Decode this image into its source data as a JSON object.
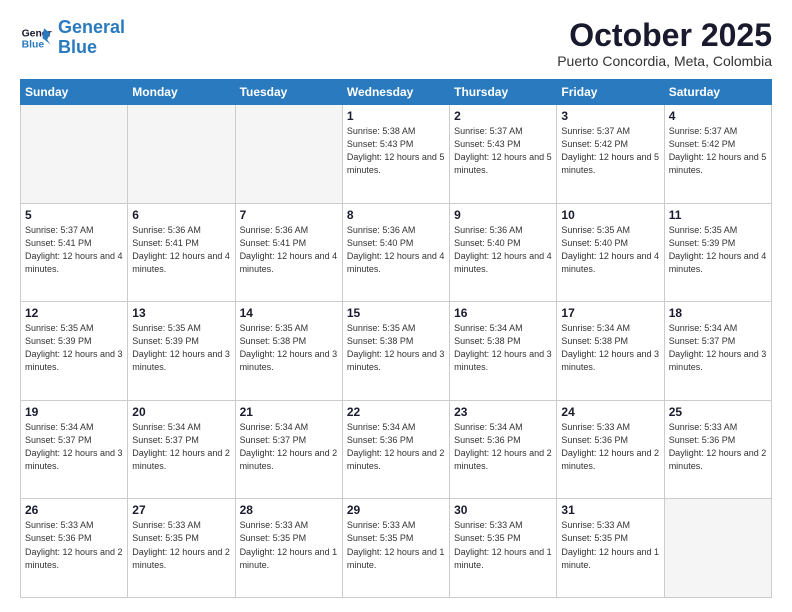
{
  "logo": {
    "line1": "General",
    "line2": "Blue"
  },
  "title": "October 2025",
  "subtitle": "Puerto Concordia, Meta, Colombia",
  "weekdays": [
    "Sunday",
    "Monday",
    "Tuesday",
    "Wednesday",
    "Thursday",
    "Friday",
    "Saturday"
  ],
  "weeks": [
    [
      null,
      null,
      null,
      {
        "day": 1,
        "sunrise": "5:38 AM",
        "sunset": "5:43 PM",
        "daylight": "12 hours and 5 minutes."
      },
      {
        "day": 2,
        "sunrise": "5:37 AM",
        "sunset": "5:43 PM",
        "daylight": "12 hours and 5 minutes."
      },
      {
        "day": 3,
        "sunrise": "5:37 AM",
        "sunset": "5:42 PM",
        "daylight": "12 hours and 5 minutes."
      },
      {
        "day": 4,
        "sunrise": "5:37 AM",
        "sunset": "5:42 PM",
        "daylight": "12 hours and 5 minutes."
      }
    ],
    [
      {
        "day": 5,
        "sunrise": "5:37 AM",
        "sunset": "5:41 PM",
        "daylight": "12 hours and 4 minutes."
      },
      {
        "day": 6,
        "sunrise": "5:36 AM",
        "sunset": "5:41 PM",
        "daylight": "12 hours and 4 minutes."
      },
      {
        "day": 7,
        "sunrise": "5:36 AM",
        "sunset": "5:41 PM",
        "daylight": "12 hours and 4 minutes."
      },
      {
        "day": 8,
        "sunrise": "5:36 AM",
        "sunset": "5:40 PM",
        "daylight": "12 hours and 4 minutes."
      },
      {
        "day": 9,
        "sunrise": "5:36 AM",
        "sunset": "5:40 PM",
        "daylight": "12 hours and 4 minutes."
      },
      {
        "day": 10,
        "sunrise": "5:35 AM",
        "sunset": "5:40 PM",
        "daylight": "12 hours and 4 minutes."
      },
      {
        "day": 11,
        "sunrise": "5:35 AM",
        "sunset": "5:39 PM",
        "daylight": "12 hours and 4 minutes."
      }
    ],
    [
      {
        "day": 12,
        "sunrise": "5:35 AM",
        "sunset": "5:39 PM",
        "daylight": "12 hours and 3 minutes."
      },
      {
        "day": 13,
        "sunrise": "5:35 AM",
        "sunset": "5:39 PM",
        "daylight": "12 hours and 3 minutes."
      },
      {
        "day": 14,
        "sunrise": "5:35 AM",
        "sunset": "5:38 PM",
        "daylight": "12 hours and 3 minutes."
      },
      {
        "day": 15,
        "sunrise": "5:35 AM",
        "sunset": "5:38 PM",
        "daylight": "12 hours and 3 minutes."
      },
      {
        "day": 16,
        "sunrise": "5:34 AM",
        "sunset": "5:38 PM",
        "daylight": "12 hours and 3 minutes."
      },
      {
        "day": 17,
        "sunrise": "5:34 AM",
        "sunset": "5:38 PM",
        "daylight": "12 hours and 3 minutes."
      },
      {
        "day": 18,
        "sunrise": "5:34 AM",
        "sunset": "5:37 PM",
        "daylight": "12 hours and 3 minutes."
      }
    ],
    [
      {
        "day": 19,
        "sunrise": "5:34 AM",
        "sunset": "5:37 PM",
        "daylight": "12 hours and 3 minutes."
      },
      {
        "day": 20,
        "sunrise": "5:34 AM",
        "sunset": "5:37 PM",
        "daylight": "12 hours and 2 minutes."
      },
      {
        "day": 21,
        "sunrise": "5:34 AM",
        "sunset": "5:37 PM",
        "daylight": "12 hours and 2 minutes."
      },
      {
        "day": 22,
        "sunrise": "5:34 AM",
        "sunset": "5:36 PM",
        "daylight": "12 hours and 2 minutes."
      },
      {
        "day": 23,
        "sunrise": "5:34 AM",
        "sunset": "5:36 PM",
        "daylight": "12 hours and 2 minutes."
      },
      {
        "day": 24,
        "sunrise": "5:33 AM",
        "sunset": "5:36 PM",
        "daylight": "12 hours and 2 minutes."
      },
      {
        "day": 25,
        "sunrise": "5:33 AM",
        "sunset": "5:36 PM",
        "daylight": "12 hours and 2 minutes."
      }
    ],
    [
      {
        "day": 26,
        "sunrise": "5:33 AM",
        "sunset": "5:36 PM",
        "daylight": "12 hours and 2 minutes."
      },
      {
        "day": 27,
        "sunrise": "5:33 AM",
        "sunset": "5:35 PM",
        "daylight": "12 hours and 2 minutes."
      },
      {
        "day": 28,
        "sunrise": "5:33 AM",
        "sunset": "5:35 PM",
        "daylight": "12 hours and 1 minute."
      },
      {
        "day": 29,
        "sunrise": "5:33 AM",
        "sunset": "5:35 PM",
        "daylight": "12 hours and 1 minute."
      },
      {
        "day": 30,
        "sunrise": "5:33 AM",
        "sunset": "5:35 PM",
        "daylight": "12 hours and 1 minute."
      },
      {
        "day": 31,
        "sunrise": "5:33 AM",
        "sunset": "5:35 PM",
        "daylight": "12 hours and 1 minute."
      },
      null
    ]
  ]
}
